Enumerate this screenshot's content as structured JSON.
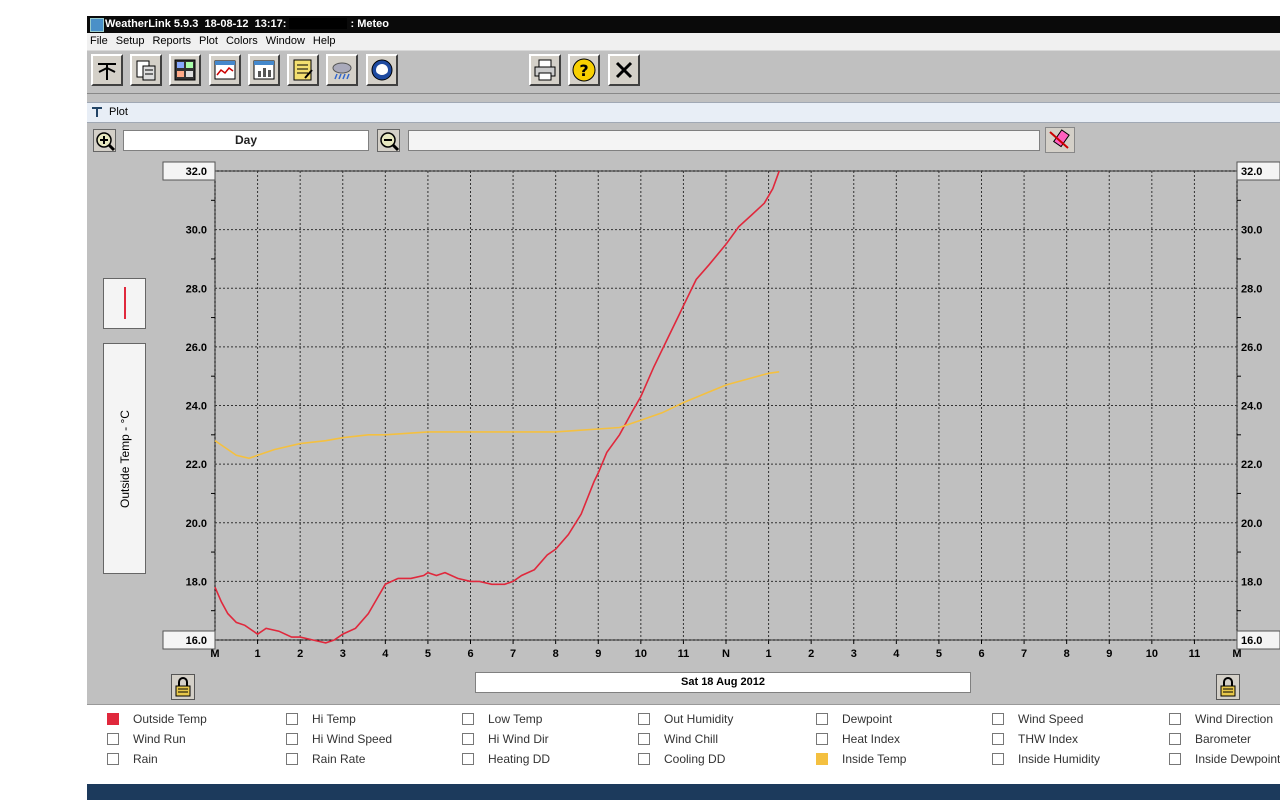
{
  "window": {
    "title_left": "WeatherLink 5.9.3  18-08-12  13:17:",
    "title_right": ": Meteo"
  },
  "menu": [
    "File",
    "Setup",
    "Reports",
    "Plot",
    "Colors",
    "Window",
    "Help"
  ],
  "toolbar": {
    "buttons": [
      {
        "name": "connect-icon"
      },
      {
        "name": "download-icon"
      },
      {
        "name": "bulletin-icon"
      },
      {
        "name": "strip-chart-icon"
      },
      {
        "name": "plot-icon"
      },
      {
        "name": "notepad-icon"
      },
      {
        "name": "weather-icon"
      },
      {
        "name": "noaa-icon"
      }
    ],
    "print_icon": "printer-icon",
    "help_icon": "help-icon",
    "close_icon": "close-icon"
  },
  "panel": {
    "title": "Plot"
  },
  "controls": {
    "period": "Day",
    "range_value": ""
  },
  "chart_data": {
    "type": "line",
    "ylabel": "Outside Temp - °C",
    "ylim": [
      16.0,
      32.0
    ],
    "yticks": [
      "32.0",
      "30.0",
      "28.0",
      "26.0",
      "24.0",
      "22.0",
      "20.0",
      "18.0",
      "16.0"
    ],
    "xticks": [
      "M",
      "1",
      "2",
      "3",
      "4",
      "5",
      "6",
      "7",
      "8",
      "9",
      "10",
      "11",
      "N",
      "1",
      "2",
      "3",
      "4",
      "5",
      "6",
      "7",
      "8",
      "9",
      "10",
      "11",
      "M"
    ],
    "xlim": [
      0,
      24
    ],
    "date_label": "Sat 18 Aug 2012",
    "series": [
      {
        "name": "Outside Temp",
        "color": "#e0283c",
        "x": [
          0.0,
          0.15,
          0.3,
          0.5,
          0.7,
          1.0,
          1.2,
          1.5,
          1.8,
          2.0,
          2.3,
          2.6,
          2.8,
          3.0,
          3.3,
          3.6,
          3.8,
          4.0,
          4.3,
          4.6,
          4.9,
          5.0,
          5.2,
          5.4,
          5.7,
          6.0,
          6.2,
          6.5,
          6.8,
          7.0,
          7.2,
          7.5,
          7.8,
          8.0,
          8.3,
          8.6,
          8.9,
          9.0,
          9.2,
          9.5,
          9.8,
          10.0,
          10.3,
          10.6,
          10.9,
          11.0,
          11.3,
          11.6,
          12.0,
          12.3,
          12.6,
          12.9,
          13.1,
          13.25
        ],
        "y": [
          17.8,
          17.3,
          16.9,
          16.6,
          16.5,
          16.2,
          16.4,
          16.3,
          16.1,
          16.1,
          16.0,
          15.9,
          16.0,
          16.2,
          16.4,
          16.9,
          17.4,
          17.9,
          18.1,
          18.1,
          18.2,
          18.3,
          18.2,
          18.3,
          18.1,
          18.0,
          18.0,
          17.9,
          17.9,
          18.0,
          18.2,
          18.4,
          18.9,
          19.1,
          19.6,
          20.3,
          21.4,
          21.7,
          22.4,
          23.0,
          23.8,
          24.3,
          25.3,
          26.2,
          27.1,
          27.4,
          28.3,
          28.8,
          29.5,
          30.1,
          30.5,
          30.9,
          31.4,
          32.0
        ]
      },
      {
        "name": "Inside Temp",
        "color": "#f4c040",
        "x": [
          0.0,
          0.2,
          0.5,
          0.8,
          1.0,
          1.4,
          2.0,
          2.6,
          3.0,
          3.6,
          4.0,
          5.0,
          6.0,
          7.0,
          8.0,
          8.5,
          9.0,
          9.5,
          10.0,
          10.5,
          11.0,
          11.5,
          12.0,
          12.5,
          13.0,
          13.25
        ],
        "y": [
          22.8,
          22.6,
          22.3,
          22.2,
          22.3,
          22.5,
          22.7,
          22.8,
          22.9,
          23.0,
          23.0,
          23.1,
          23.1,
          23.1,
          23.1,
          23.15,
          23.2,
          23.25,
          23.5,
          23.75,
          24.1,
          24.4,
          24.7,
          24.9,
          25.1,
          25.15
        ]
      }
    ],
    "grid": true
  },
  "legend": {
    "rows": [
      [
        {
          "label": "Outside Temp",
          "color": "#e0283c"
        },
        {
          "label": "Hi Temp",
          "color": ""
        },
        {
          "label": "Low Temp",
          "color": ""
        },
        {
          "label": "Out Humidity",
          "color": ""
        },
        {
          "label": "Dewpoint",
          "color": ""
        },
        {
          "label": "Wind Speed",
          "color": ""
        },
        {
          "label": "Wind Direction",
          "color": ""
        }
      ],
      [
        {
          "label": "Wind Run",
          "color": ""
        },
        {
          "label": "Hi Wind Speed",
          "color": ""
        },
        {
          "label": "Hi Wind Dir",
          "color": ""
        },
        {
          "label": "Wind Chill",
          "color": ""
        },
        {
          "label": "Heat Index",
          "color": ""
        },
        {
          "label": "THW Index",
          "color": ""
        },
        {
          "label": "Barometer",
          "color": ""
        }
      ],
      [
        {
          "label": "Rain",
          "color": ""
        },
        {
          "label": "Rain Rate",
          "color": ""
        },
        {
          "label": "Heating DD",
          "color": ""
        },
        {
          "label": "Cooling DD",
          "color": ""
        },
        {
          "label": "Inside Temp",
          "color": "#f4c040"
        },
        {
          "label": "Inside Humidity",
          "color": ""
        },
        {
          "label": "Inside Dewpoint",
          "color": ""
        }
      ]
    ]
  }
}
